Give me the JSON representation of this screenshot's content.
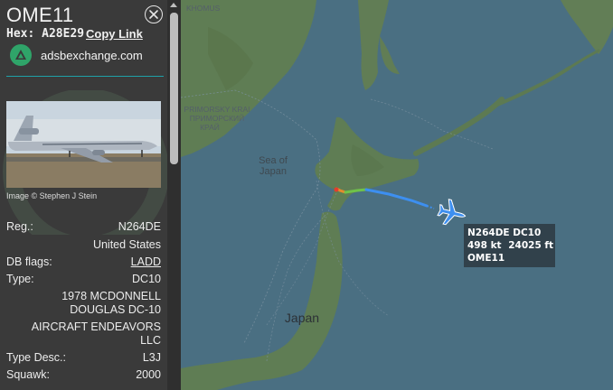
{
  "panel": {
    "callsign": "OME11",
    "hex_label": "Hex:",
    "hex": "A28E29",
    "copy_link": "Copy Link",
    "source": "adsbexchange.com",
    "photo_credit": "Image © Stephen J Stein",
    "fields": {
      "reg_label": "Reg.:",
      "reg": "N264DE",
      "country": "United States",
      "db_flags_label": "DB flags:",
      "db_flags": "LADD",
      "type_label": "Type:",
      "type": "DC10",
      "model_line1": "1978 MCDONNELL",
      "model_line2": "DOUGLAS DC-10",
      "owner_line1": "AIRCRAFT ENDEAVORS",
      "owner_line2": "LLC",
      "type_desc_label": "Type Desc.:",
      "type_desc": "L3J",
      "squawk_label": "Squawk:",
      "squawk": "2000"
    }
  },
  "map": {
    "labels": {
      "khomous": "KHOMUS",
      "primorsky_en": "PRIMORSKY KRAI",
      "primorsky_ru1": "ПРИМОРСКИЙ",
      "primorsky_ru2": "КРАЙ",
      "sea_of_japan_1": "Sea of",
      "sea_of_japan_2": "Japan",
      "japan": "Japan"
    },
    "aircraft_label": {
      "line1": "N264DE DC10",
      "speed": "498 kt",
      "altitude": "24025 ft",
      "callsign": "OME11"
    }
  },
  "colors": {
    "panel_bg": "#3a3a3a",
    "accent": "#1fa0a8",
    "adsb_green": "#2fa469",
    "sea": "#4a6f82",
    "land": "#5f7d54",
    "aircraft": "#3d8ff0"
  },
  "icons": [
    "close-icon",
    "adsb-logo-icon",
    "aircraft-icon"
  ]
}
